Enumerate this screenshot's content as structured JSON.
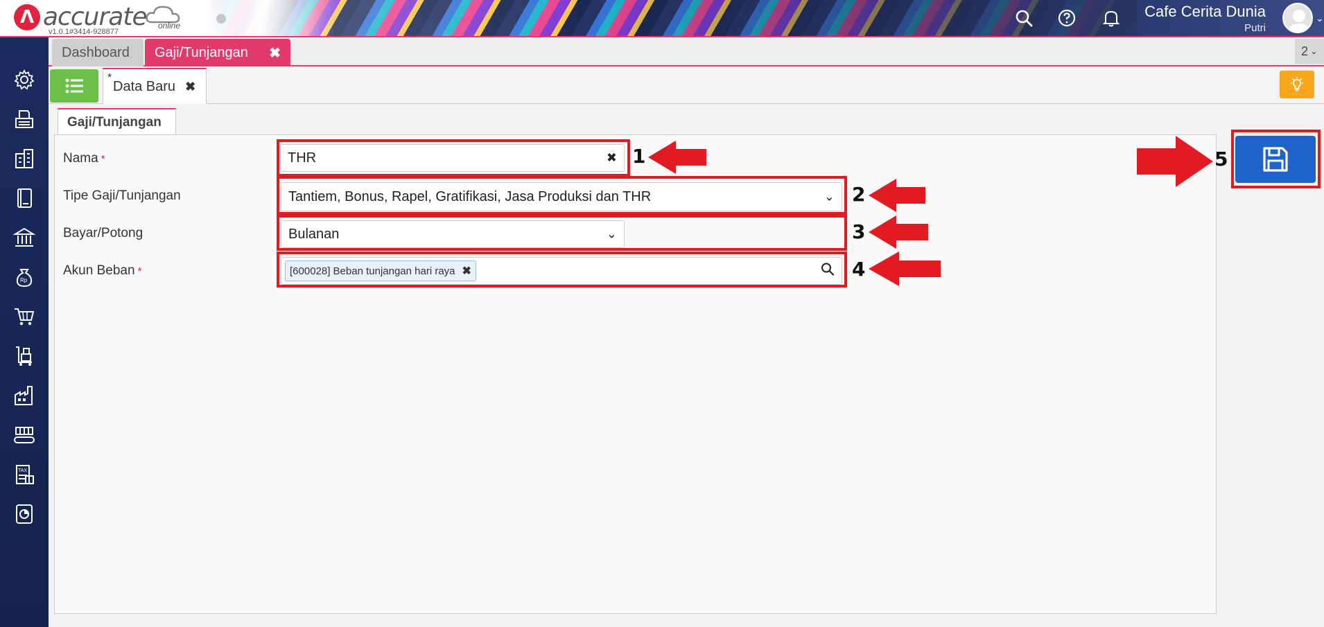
{
  "app": {
    "brand": "accurate",
    "brand_suffix": "online",
    "version": "v1.0.1#3414-928877",
    "company": "Cafe Cerita Dunia",
    "user": "Putri"
  },
  "tabs": {
    "dashboard": "Dashboard",
    "active": "Gaji/Tunjangan",
    "overflow_count": "2"
  },
  "subtab": {
    "star": "*",
    "label": "Data Baru"
  },
  "form": {
    "tab_label": "Gaji/Tunjangan",
    "nama_label": "Nama",
    "nama_value": "THR",
    "tipe_label": "Tipe Gaji/Tunjangan",
    "tipe_value": "Tantiem, Bonus, Rapel, Gratifikasi, Jasa Produksi dan THR",
    "bayar_label": "Bayar/Potong",
    "bayar_value": "Bulanan",
    "akun_label": "Akun Beban",
    "akun_chip": "[600028] Beban tunjangan hari raya",
    "required_mark": "*"
  },
  "annotations": [
    "1",
    "2",
    "3",
    "4",
    "5"
  ],
  "colors": {
    "accent_pink": "#e23a6a",
    "sidebar_navy": "#1a2b5f",
    "save_blue": "#1e63c9",
    "list_green": "#6cc04a",
    "bulb_orange": "#f7a71b",
    "annotation_red": "#e21a22"
  },
  "icons": {
    "header": [
      "search-icon",
      "help-icon",
      "bell-icon"
    ],
    "sidebar": [
      "gear-icon",
      "fax-icon",
      "building-icon",
      "book-icon",
      "bank-icon",
      "money-bag-icon",
      "cart-icon",
      "trolley-icon",
      "factory-icon",
      "conveyor-icon",
      "tax-icon",
      "report-icon"
    ]
  }
}
